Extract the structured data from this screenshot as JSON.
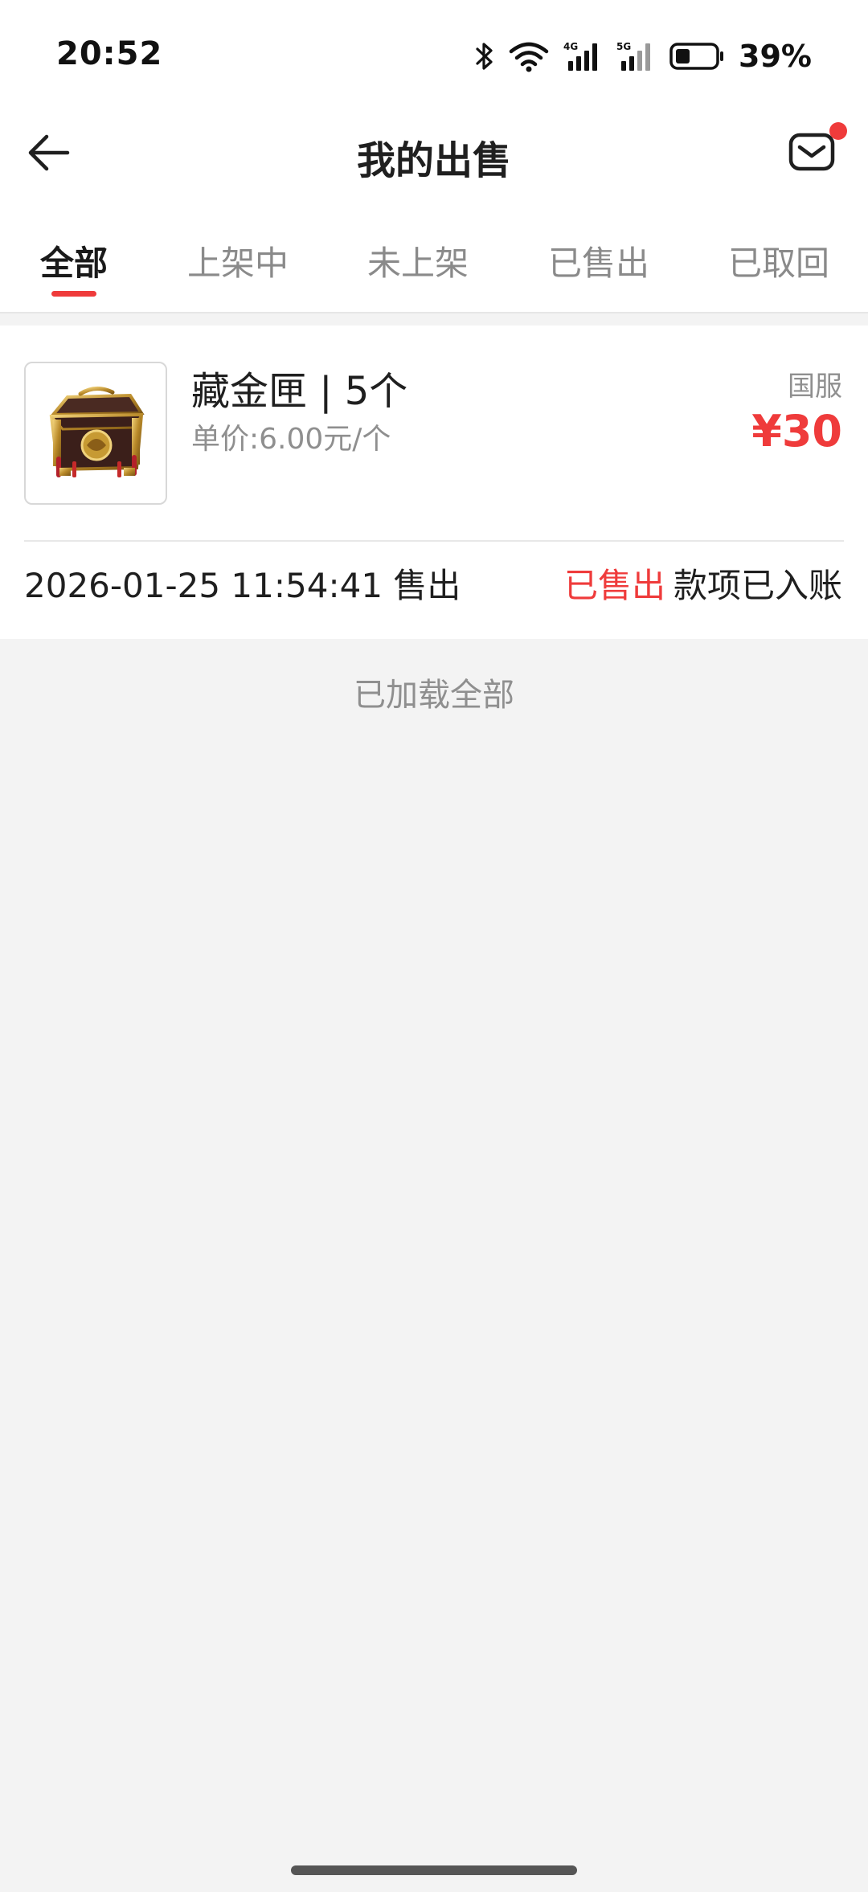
{
  "status_bar": {
    "time": "20:52",
    "battery": "39%",
    "icons": [
      "bluetooth-icon",
      "wifi-icon",
      "signal-4g-icon",
      "signal-5g-icon",
      "battery-icon"
    ]
  },
  "header": {
    "title": "我的出售",
    "back_icon": "arrow-left-icon",
    "mail_icon": "mail-icon",
    "mail_has_badge": true
  },
  "tabs": [
    {
      "label": "全部",
      "active": true
    },
    {
      "label": "上架中",
      "active": false
    },
    {
      "label": "未上架",
      "active": false
    },
    {
      "label": "已售出",
      "active": false
    },
    {
      "label": "已取回",
      "active": false
    }
  ],
  "orders": [
    {
      "name": "藏金匣 | 5个",
      "unit_price": "单价:6.00元/个",
      "region": "国服",
      "price": "¥30",
      "sold_time": "2026-01-25 11:54:41 售出",
      "status": "已售出",
      "status_note": "款项已入账"
    }
  ],
  "footer_text": "已加载全部",
  "colors": {
    "accent": "#ef3b3b",
    "background": "#f3f3f3",
    "card": "#ffffff",
    "muted_text": "#8f8f8f"
  }
}
